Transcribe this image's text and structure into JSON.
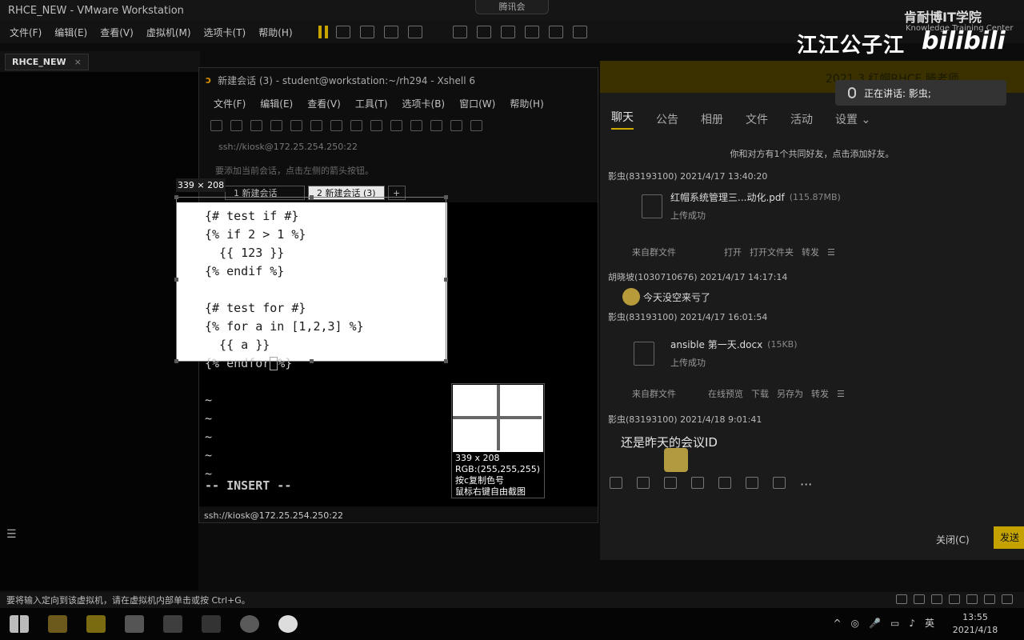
{
  "vmware": {
    "title": "RHCE_NEW - VMware Workstation",
    "menu": [
      "文件(F)",
      "编辑(E)",
      "查看(V)",
      "虚拟机(M)",
      "选项卡(T)",
      "帮助(H)"
    ],
    "tab": "RHCE_NEW",
    "tab_close": "×",
    "status_text": "要将输入定向到该虚拟机，请在虚拟机内部单击或按 Ctrl+G。"
  },
  "overlay": {
    "top_button": "腾讯会",
    "brand": "肯耐博IT学院",
    "brand_sub": "Knowledge Training Center",
    "watermark": "江江公子江",
    "bili": "bilibili"
  },
  "xshell": {
    "title": "新建会话 (3) - student@workstation:~/rh294 - Xshell 6",
    "menu": [
      "文件(F)",
      "编辑(E)",
      "查看(V)",
      "工具(T)",
      "选项卡(B)",
      "窗口(W)",
      "帮助(H)"
    ],
    "address": "ssh://kiosk@172.25.254.250:22",
    "hint": "要添加当前会话，点击左侧的箭头按钮。",
    "tab1": "1 新建会话",
    "tab2": "2 新建会话 (3)",
    "tab_add": "+",
    "status": "ssh://kiosk@172.25.254.250:22",
    "lines": [
      "{# test if #}",
      "{% if 2 > 1 %}",
      "  {{ 123 }}",
      "{% endif %}",
      "",
      "{# test for #}",
      "{% for a in [1,2,3] %}",
      "  {{ a }}"
    ],
    "line_endfor_a": "{% endfor",
    "line_endfor_b": "%}",
    "tildes": [
      "~",
      "~",
      "~",
      "~",
      "~"
    ],
    "mode": "-- INSERT --"
  },
  "snip": {
    "dimensions": "339 × 208",
    "mag_size": "339 x 208",
    "mag_rgb": "RGB:(255,255,255)",
    "mag_copy": "按c复制色号",
    "mag_free": "鼠标右键自由截图"
  },
  "chat": {
    "header_title": "2021.3 红帽RHCE 滕老师",
    "speaking": "正在讲话: 影虫;",
    "tabs": [
      "聊天",
      "公告",
      "相册",
      "文件",
      "活动",
      "设置 ⌄"
    ],
    "system_msg": "你和对方有1个共同好友，点击添加好友。",
    "messages": [
      {
        "sender": "影虫(83193100) 2021/4/17 13:40:20",
        "file_name": "红帽系统管理三...动化.pdf",
        "file_size": "(115.87MB)",
        "file_status": "上传成功",
        "source": "来自群文件",
        "actions": [
          "打开",
          "打开文件夹",
          "转发",
          "☰"
        ]
      },
      {
        "sender": "胡晓坡(1030710676) 2021/4/17 14:17:14",
        "text": "今天没空来亏了"
      },
      {
        "sender": "影虫(83193100) 2021/4/17 16:01:54",
        "file_name": "ansible 第一天.docx",
        "file_size": "(15KB)",
        "file_status": "上传成功",
        "source": "来自群文件",
        "actions": [
          "在线预览",
          "下载",
          "另存为",
          "转发",
          "☰"
        ]
      },
      {
        "sender": "影虫(83193100) 2021/4/18 9:01:41",
        "text": "还是昨天的会议ID"
      }
    ],
    "close": "关闭(C)",
    "send": "发送"
  },
  "taskbar": {
    "time": "13:55",
    "date": "2021/4/18",
    "lang": "英",
    "tray": [
      "^",
      "◎",
      "🎤",
      "▭",
      "♪"
    ]
  }
}
